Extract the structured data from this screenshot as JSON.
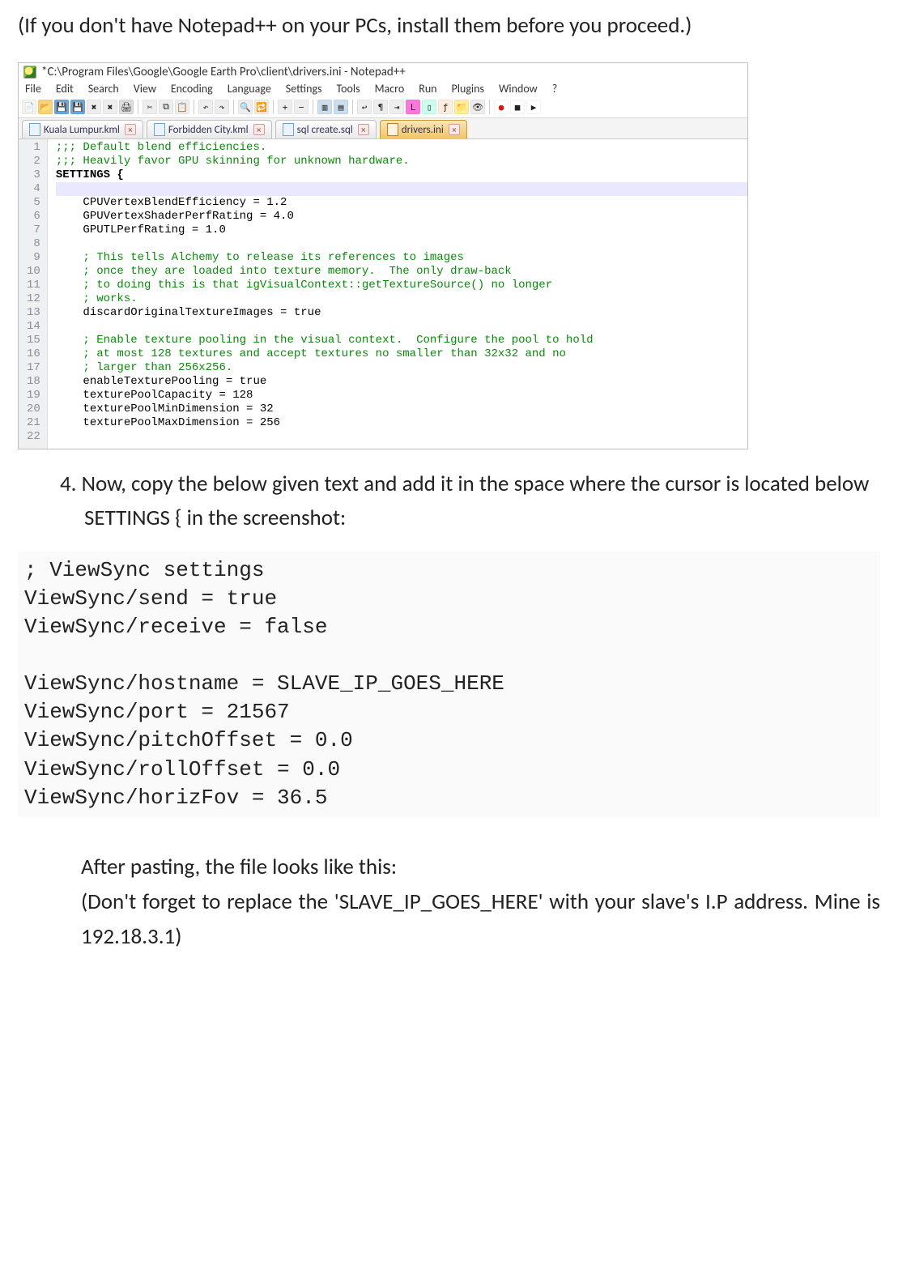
{
  "intro": "(If you don't have Notepad++ on your PCs, install them before you proceed.)",
  "screenshot": {
    "title": "*C:\\Program Files\\Google\\Google Earth Pro\\client\\drivers.ini - Notepad++",
    "menus": [
      "File",
      "Edit",
      "Search",
      "View",
      "Encoding",
      "Language",
      "Settings",
      "Tools",
      "Macro",
      "Run",
      "Plugins",
      "Window",
      "?"
    ],
    "tabs": [
      {
        "label": "Kuala Lumpur.kml",
        "active": false
      },
      {
        "label": "Forbidden City.kml",
        "active": false
      },
      {
        "label": "sql create.sql",
        "active": false
      },
      {
        "label": "drivers.ini",
        "active": true
      }
    ],
    "lines": [
      {
        "n": 1,
        "cls": "c-comment",
        "text": ";;; Default blend efficiencies."
      },
      {
        "n": 2,
        "cls": "c-comment",
        "text": ";;; Heavily favor GPU skinning for unknown hardware."
      },
      {
        "n": 3,
        "cls": "c-key",
        "text": "SETTINGS {"
      },
      {
        "n": 4,
        "cls": "c-plain cursor",
        "text": "    "
      },
      {
        "n": 5,
        "cls": "c-plain",
        "text": "    CPUVertexBlendEfficiency = 1.2"
      },
      {
        "n": 6,
        "cls": "c-plain",
        "text": "    GPUVertexShaderPerfRating = 4.0"
      },
      {
        "n": 7,
        "cls": "c-plain",
        "text": "    GPUTLPerfRating = 1.0"
      },
      {
        "n": 8,
        "cls": "c-plain",
        "text": ""
      },
      {
        "n": 9,
        "cls": "c-comment",
        "text": "    ; This tells Alchemy to release its references to images"
      },
      {
        "n": 10,
        "cls": "c-comment",
        "text": "    ; once they are loaded into texture memory.  The only draw-back"
      },
      {
        "n": 11,
        "cls": "c-comment",
        "text": "    ; to doing this is that igVisualContext::getTextureSource() no longer"
      },
      {
        "n": 12,
        "cls": "c-comment",
        "text": "    ; works."
      },
      {
        "n": 13,
        "cls": "c-plain",
        "text": "    discardOriginalTextureImages = true"
      },
      {
        "n": 14,
        "cls": "c-plain",
        "text": ""
      },
      {
        "n": 15,
        "cls": "c-comment",
        "text": "    ; Enable texture pooling in the visual context.  Configure the pool to hold"
      },
      {
        "n": 16,
        "cls": "c-comment",
        "text": "    ; at most 128 textures and accept textures no smaller than 32x32 and no"
      },
      {
        "n": 17,
        "cls": "c-comment",
        "text": "    ; larger than 256x256."
      },
      {
        "n": 18,
        "cls": "c-plain",
        "text": "    enableTexturePooling = true"
      },
      {
        "n": 19,
        "cls": "c-plain",
        "text": "    texturePoolCapacity = 128"
      },
      {
        "n": 20,
        "cls": "c-plain",
        "text": "    texturePoolMinDimension = 32"
      },
      {
        "n": 21,
        "cls": "c-plain",
        "text": "    texturePoolMaxDimension = 256"
      },
      {
        "n": 22,
        "cls": "c-plain",
        "text": ""
      }
    ]
  },
  "step4": "4. Now, copy the below given text and add it in the space where the cursor is located below SETTINGS { in the screenshot:",
  "codeblock": "; ViewSync settings\nViewSync/send = true\nViewSync/receive = false\n\nViewSync/hostname = SLAVE_IP_GOES_HERE\nViewSync/port = 21567\nViewSync/pitchOffset = 0.0\nViewSync/rollOffset = 0.0\nViewSync/horizFov = 36.5",
  "after1": "After pasting, the file looks like this:",
  "after2": "(Don't forget to replace the 'SLAVE_IP_GOES_HERE' with your slave's I.P address. Mine is 192.18.3.1)",
  "toolbar_icons": [
    {
      "name": "new-icon",
      "bg": "#f8f4e8",
      "fg": "📄"
    },
    {
      "name": "open-icon",
      "bg": "#f6d27a",
      "fg": "📂"
    },
    {
      "name": "save-icon",
      "bg": "#6aa6e6",
      "fg": "💾"
    },
    {
      "name": "save-all-icon",
      "bg": "#6aa6e6",
      "fg": "💾"
    },
    {
      "name": "close-icon",
      "bg": "#eee",
      "fg": "✖"
    },
    {
      "name": "close-all-icon",
      "bg": "#eee",
      "fg": "✖"
    },
    {
      "name": "print-icon",
      "bg": "#ddd",
      "fg": "🖨"
    },
    {
      "name": "sep",
      "bg": "",
      "fg": ""
    },
    {
      "name": "cut-icon",
      "bg": "#eee",
      "fg": "✂"
    },
    {
      "name": "copy-icon",
      "bg": "#eee",
      "fg": "⧉"
    },
    {
      "name": "paste-icon",
      "bg": "#eee",
      "fg": "📋"
    },
    {
      "name": "sep",
      "bg": "",
      "fg": ""
    },
    {
      "name": "undo-icon",
      "bg": "#eee",
      "fg": "↶"
    },
    {
      "name": "redo-icon",
      "bg": "#eee",
      "fg": "↷"
    },
    {
      "name": "sep",
      "bg": "",
      "fg": ""
    },
    {
      "name": "find-icon",
      "bg": "#eee",
      "fg": "🔍"
    },
    {
      "name": "replace-icon",
      "bg": "#eee",
      "fg": "🔁"
    },
    {
      "name": "sep",
      "bg": "",
      "fg": ""
    },
    {
      "name": "zoom-in-icon",
      "bg": "#eee",
      "fg": "+"
    },
    {
      "name": "zoom-out-icon",
      "bg": "#eee",
      "fg": "−"
    },
    {
      "name": "sep",
      "bg": "",
      "fg": ""
    },
    {
      "name": "sync-v-icon",
      "bg": "#cde",
      "fg": "▥"
    },
    {
      "name": "sync-h-icon",
      "bg": "#cde",
      "fg": "▤"
    },
    {
      "name": "sep",
      "bg": "",
      "fg": ""
    },
    {
      "name": "wordwrap-icon",
      "bg": "#eee",
      "fg": "↩"
    },
    {
      "name": "show-all-icon",
      "bg": "#eee",
      "fg": "¶"
    },
    {
      "name": "indent-guide-icon",
      "bg": "#eee",
      "fg": "⇥"
    },
    {
      "name": "lang-icon",
      "bg": "#f7d",
      "fg": "L"
    },
    {
      "name": "doc-map-icon",
      "bg": "#cfe",
      "fg": "▯"
    },
    {
      "name": "func-list-icon",
      "bg": "#fed",
      "fg": "ƒ"
    },
    {
      "name": "folder-icon",
      "bg": "#fe9",
      "fg": "📁"
    },
    {
      "name": "monitor-icon",
      "bg": "#eee",
      "fg": "👁"
    },
    {
      "name": "sep",
      "bg": "",
      "fg": ""
    },
    {
      "name": "record-icon",
      "bg": "#fff",
      "fg": "●"
    },
    {
      "name": "stop-icon",
      "bg": "#fff",
      "fg": "■"
    },
    {
      "name": "play-icon",
      "bg": "#fff",
      "fg": "▶"
    }
  ]
}
